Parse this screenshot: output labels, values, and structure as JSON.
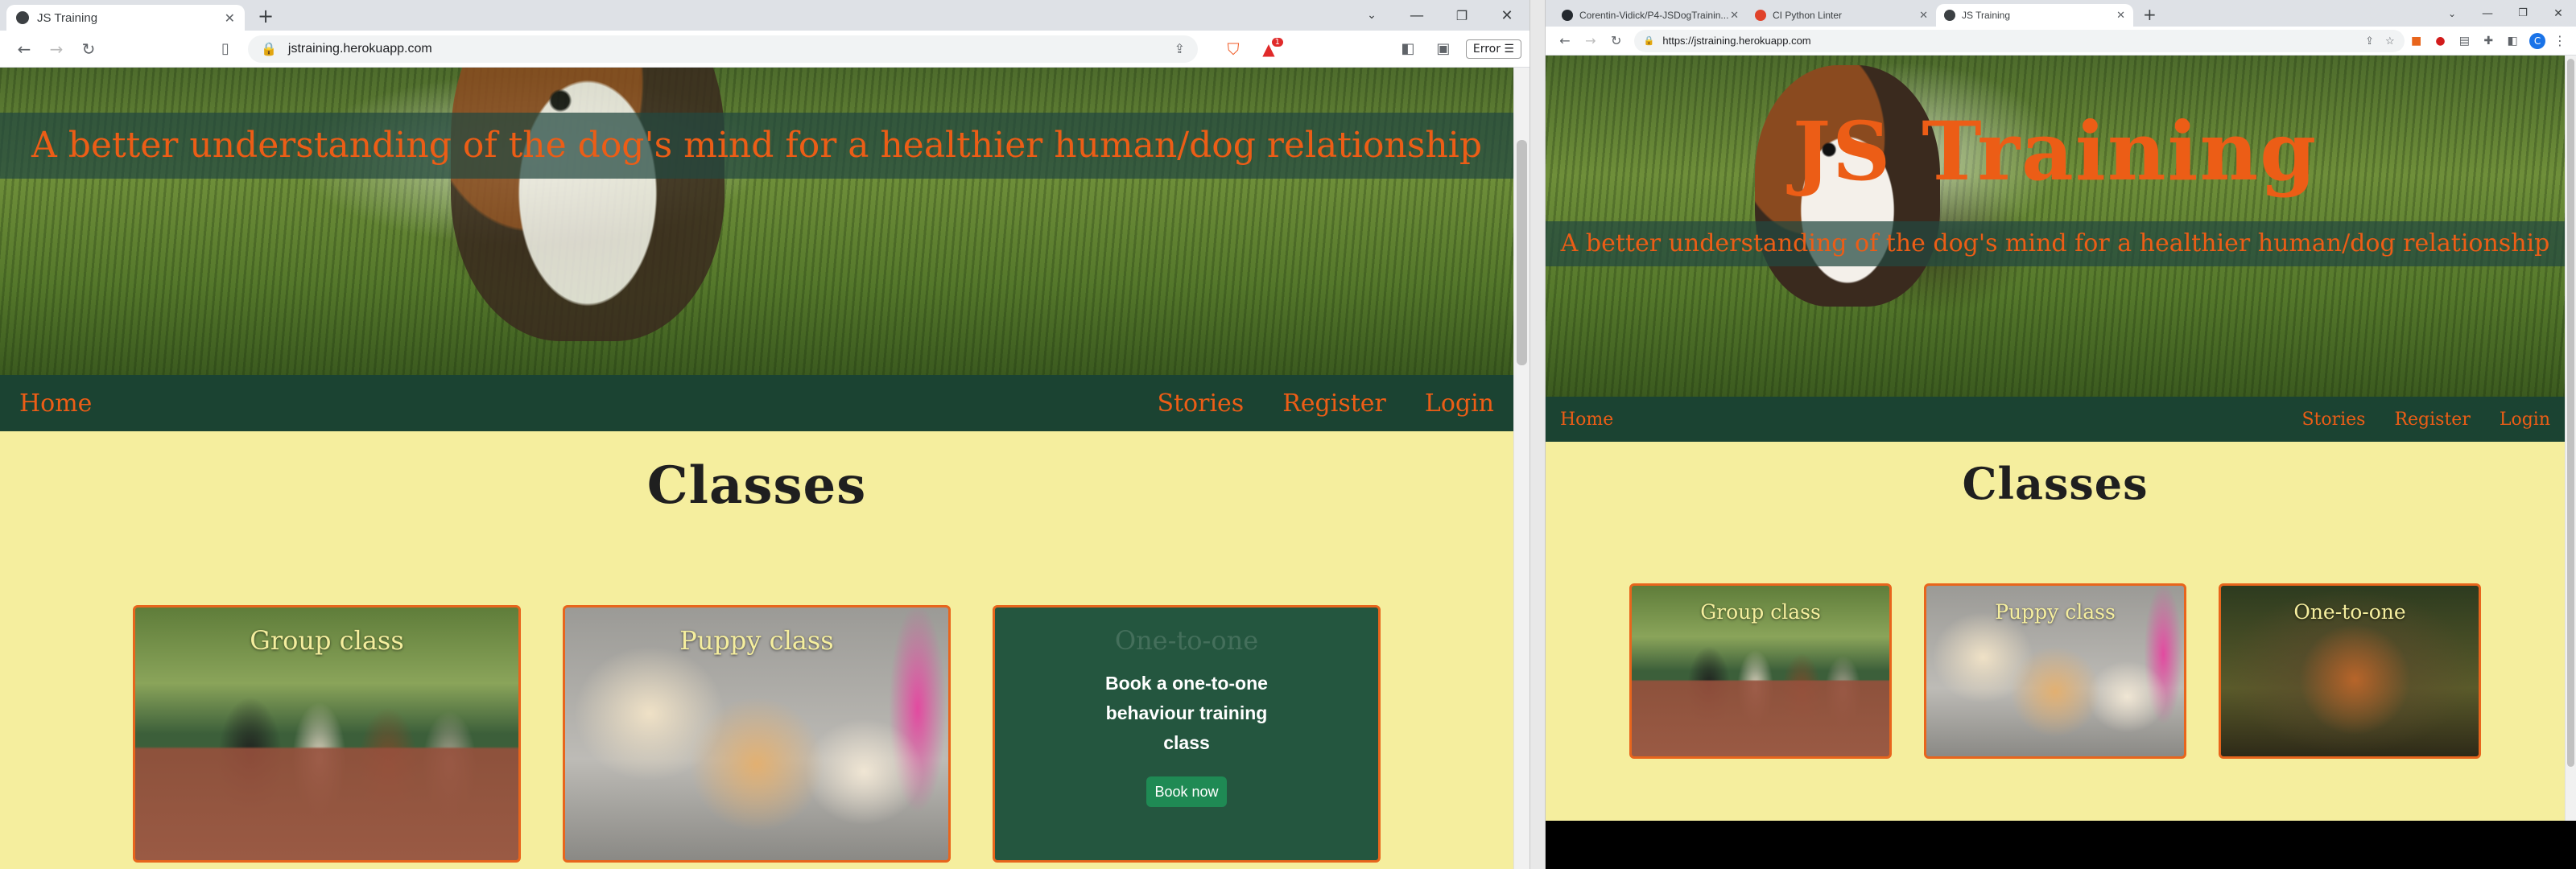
{
  "left_browser": {
    "tab_title": "JS Training",
    "url": "jstraining.herokuapp.com",
    "error_label": "Error",
    "notification_count": "1"
  },
  "right_browser": {
    "tabs": [
      {
        "title": "Corentin-Vidick/P4-JSDogTrainin..."
      },
      {
        "title": "CI Python Linter"
      },
      {
        "title": "JS Training"
      }
    ],
    "url": "https://jstraining.herokuapp.com",
    "profile_initial": "C"
  },
  "site": {
    "title": "JS Training",
    "tagline": "A better understanding of the dog's mind for a healthier human/dog relationship",
    "nav": {
      "home": "Home",
      "stories": "Stories",
      "register": "Register",
      "login": "Login"
    },
    "classes_heading": "Classes",
    "cards": [
      {
        "title": "Group class",
        "image": "dogs-on-leash-photo"
      },
      {
        "title": "Puppy class",
        "image": "golden-puppies-photo"
      },
      {
        "title": "One-to-one",
        "image": "brown-dog-photo"
      }
    ],
    "hover_card": {
      "title": "One-to-one",
      "text_line1": "Book a one-to-one",
      "text_line2": "behaviour training",
      "text_line3": "class",
      "button": "Book now"
    }
  },
  "colors": {
    "accent_orange": "#ec5d16",
    "nav_green": "#1b4332",
    "page_yellow": "#f5ee9e",
    "card_border": "#e8651c",
    "button_green": "#1f8a54"
  },
  "icons": [
    "back-arrow-icon",
    "forward-arrow-icon",
    "reload-icon",
    "bookmark-icon",
    "lock-icon",
    "share-icon",
    "brave-shield-icon",
    "brave-rewards-icon",
    "sidebar-icon",
    "wallet-icon",
    "menu-icon",
    "star-icon",
    "extensions-icon",
    "more-icon",
    "minimize-icon",
    "maximize-icon",
    "close-icon",
    "github-icon",
    "ci-linter-icon"
  ]
}
